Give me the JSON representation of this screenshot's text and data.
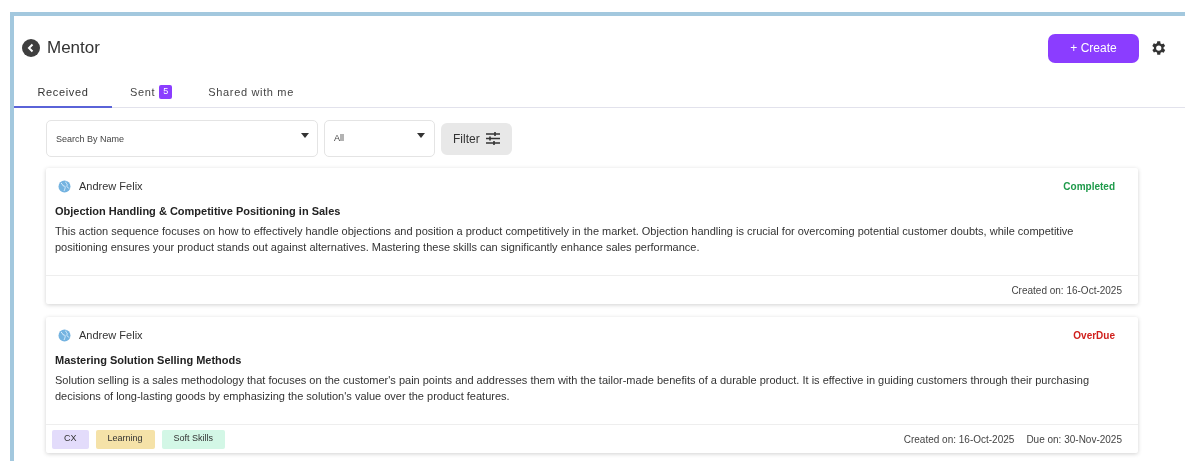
{
  "header": {
    "title": "Mentor",
    "create_button": "+ Create"
  },
  "tabs": [
    {
      "label": "Received",
      "selected": true
    },
    {
      "label": "Sent",
      "selected": false,
      "badge": "5"
    },
    {
      "label": "Shared with me",
      "selected": false
    }
  ],
  "filters": {
    "search": {
      "placeholder": "Search By Name"
    },
    "status_select": {
      "value": "All"
    },
    "filter_button": "Filter"
  },
  "cards": [
    {
      "author": "Andrew Felix",
      "status": "Completed",
      "kind": "completed",
      "title": "Objection Handling & Competitive Positioning in Sales",
      "description": "This action sequence focuses on how to effectively handle objections and position a product competitively in the market. Objection handling is crucial for overcoming potential customer doubts, while competitive positioning ensures your product stands out against alternatives. Mastering these skills can significantly enhance sales performance.",
      "dates": [
        "Created on: 16-Oct-2025"
      ]
    },
    {
      "author": "Andrew Felix",
      "status": "OverDue",
      "kind": "overdue",
      "title": "Mastering Solution Selling Methods",
      "description": "Solution selling is a sales methodology that focuses on the customer's pain points and addresses them with the tailor-made benefits of a durable product. It is effective in guiding customers through their purchasing decisions of long-lasting goods by emphasizing the solution's value over the product features.",
      "tags": [
        {
          "label": "CX",
          "color": "#e3dcfb"
        },
        {
          "label": "Learning",
          "color": "#f5e2a8"
        },
        {
          "label": "Soft Skills",
          "color": "#d3f7e6"
        }
      ],
      "dates": [
        "Created on: 16-Oct-2025",
        "Due on: 30-Nov-2025"
      ]
    }
  ]
}
